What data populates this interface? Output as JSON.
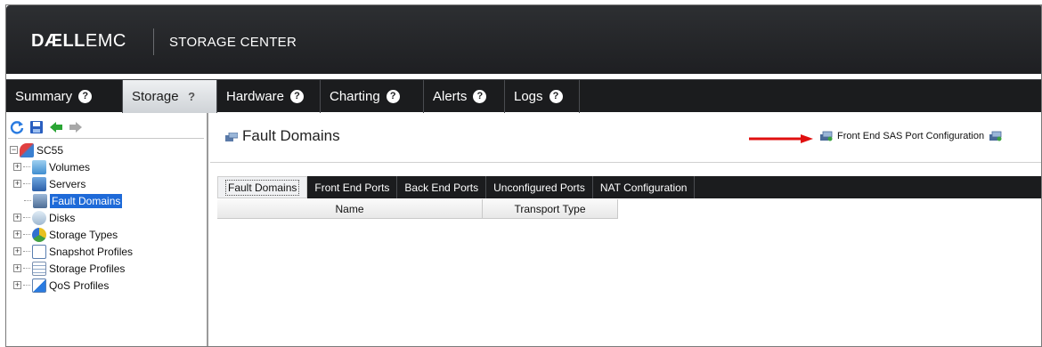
{
  "header": {
    "logo_bold": "DÆLL",
    "logo_light": "EMC",
    "product": "STORAGE CENTER"
  },
  "nav": {
    "tabs": [
      {
        "label": "Summary",
        "active": false
      },
      {
        "label": "Storage",
        "active": true
      },
      {
        "label": "Hardware",
        "active": false
      },
      {
        "label": "Charting",
        "active": false
      },
      {
        "label": "Alerts",
        "active": false
      },
      {
        "label": "Logs",
        "active": false
      }
    ],
    "help_glyph": "?"
  },
  "tree": {
    "root": "SC55",
    "items": [
      {
        "label": "Volumes",
        "icon": "volumes-icon"
      },
      {
        "label": "Servers",
        "icon": "servers-icon"
      },
      {
        "label": "Fault Domains",
        "icon": "fault-domains-icon",
        "selected": true
      },
      {
        "label": "Disks",
        "icon": "disks-icon"
      },
      {
        "label": "Storage Types",
        "icon": "storage-types-icon"
      },
      {
        "label": "Snapshot Profiles",
        "icon": "snapshot-profiles-icon"
      },
      {
        "label": "Storage Profiles",
        "icon": "storage-profiles-icon"
      },
      {
        "label": "QoS Profiles",
        "icon": "qos-profiles-icon"
      }
    ],
    "expander_glyph": "+",
    "root_expander_glyph": "−"
  },
  "main": {
    "title": "Fault Domains",
    "action_link": "Front End SAS Port Configuration",
    "tabs": [
      "Fault Domains",
      "Front End Ports",
      "Back End Ports",
      "Unconfigured Ports",
      "NAT Configuration"
    ],
    "columns": [
      "Name",
      "Transport Type"
    ]
  },
  "colors": {
    "header_bg": "#222326",
    "nav_bg": "#1b1c1e",
    "selected": "#1e6ad8",
    "arrow": "#e01010"
  }
}
